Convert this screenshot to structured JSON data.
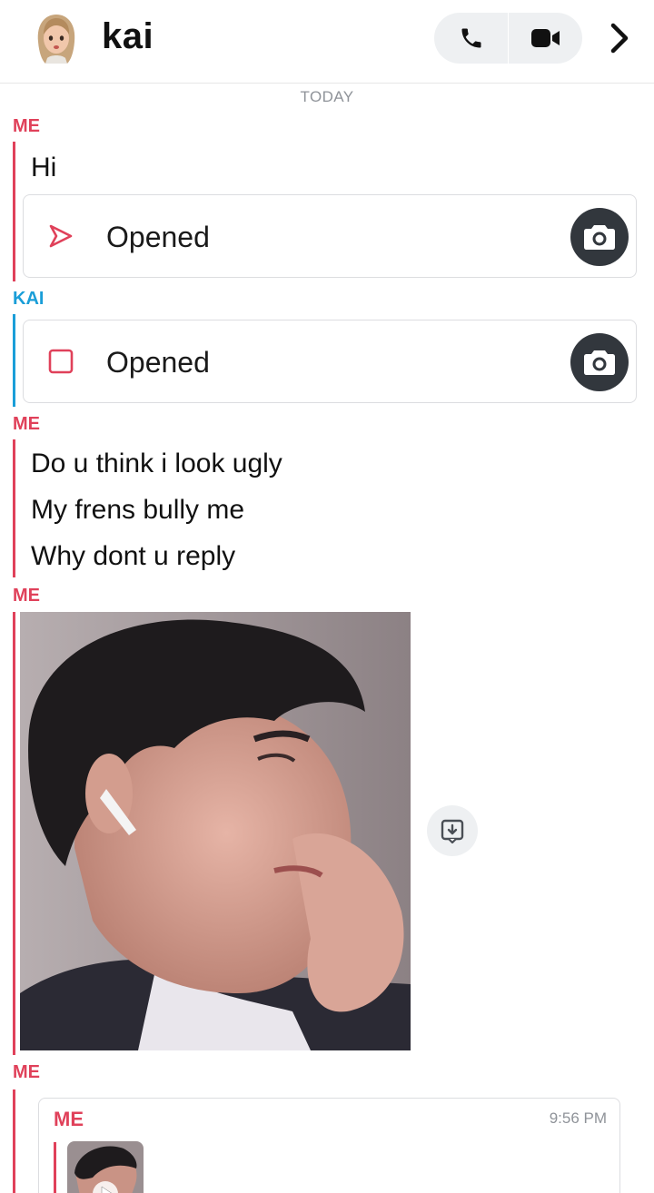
{
  "header": {
    "title": "kai",
    "icons": [
      "bitmoji-avatar",
      "phone-icon",
      "video-icon",
      "chevron-right-icon"
    ]
  },
  "date_divider": "TODAY",
  "thread": {
    "block1": {
      "sender": "ME",
      "text": "Hi",
      "opened": "Opened",
      "opened_icon": "sent-arrow-icon"
    },
    "block2": {
      "sender": "KAI",
      "opened": "Opened",
      "opened_icon": "received-square-icon"
    },
    "block3": {
      "sender": "ME",
      "lines": [
        "Do u think i look ugly",
        "My frens bully me",
        "Why dont u reply"
      ]
    },
    "block4": {
      "sender": "ME",
      "media": "photo"
    },
    "block5": {
      "sender": "ME",
      "reply_sender": "ME",
      "reply_time": "9:56 PM"
    }
  },
  "colors": {
    "me": "#e0415a",
    "kai": "#1a9ed8",
    "dark_button": "#32373d",
    "muted": "#8f9399"
  }
}
